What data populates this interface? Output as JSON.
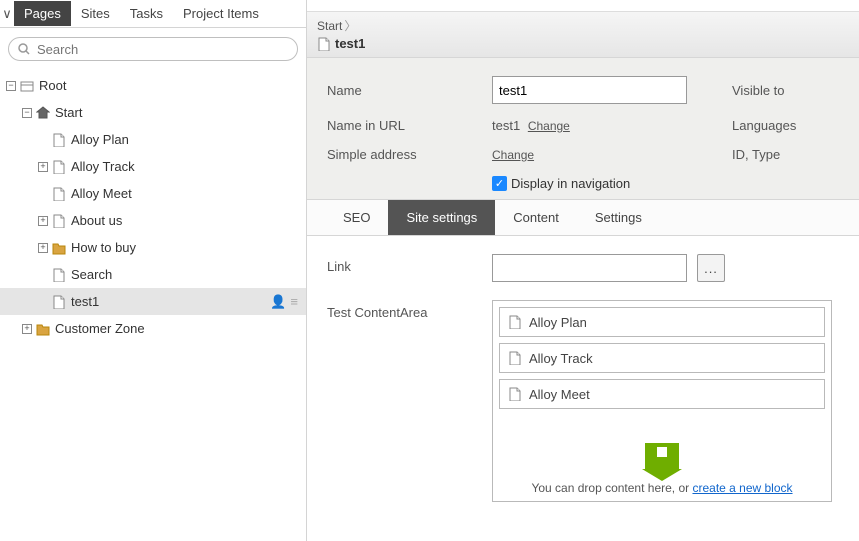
{
  "sidebar": {
    "tabs": [
      {
        "label": "Pages",
        "active": true
      },
      {
        "label": "Sites",
        "active": false
      },
      {
        "label": "Tasks",
        "active": false
      },
      {
        "label": "Project Items",
        "active": false
      }
    ],
    "search_placeholder": "Search",
    "tree": {
      "root_label": "Root",
      "start_label": "Start",
      "items": [
        {
          "label": "Alloy Plan",
          "type": "page",
          "expander": null
        },
        {
          "label": "Alloy Track",
          "type": "page",
          "expander": "+"
        },
        {
          "label": "Alloy Meet",
          "type": "page",
          "expander": null
        },
        {
          "label": "About us",
          "type": "page",
          "expander": "+"
        },
        {
          "label": "How to buy",
          "type": "folder",
          "expander": "+"
        },
        {
          "label": "Search",
          "type": "page",
          "expander": null
        },
        {
          "label": "test1",
          "type": "page",
          "expander": null,
          "selected": true
        }
      ],
      "customer_zone_label": "Customer Zone"
    }
  },
  "breadcrumb": {
    "root": "Start",
    "current": "test1"
  },
  "form": {
    "name_label": "Name",
    "name_value": "test1",
    "url_label": "Name in URL",
    "url_value": "test1",
    "change_label": "Change",
    "simple_label": "Simple address",
    "display_nav": "Display in navigation",
    "visible_label": "Visible to",
    "languages_label": "Languages",
    "idtype_label": "ID, Type"
  },
  "editor_tabs": [
    {
      "label": "SEO",
      "active": false
    },
    {
      "label": "Site settings",
      "active": true
    },
    {
      "label": "Content",
      "active": false
    },
    {
      "label": "Settings",
      "active": false
    }
  ],
  "fields": {
    "link_label": "Link",
    "picker_label": "...",
    "ca_label": "Test ContentArea",
    "ca_items": [
      {
        "label": "Alloy Plan"
      },
      {
        "label": "Alloy Track"
      },
      {
        "label": "Alloy Meet"
      }
    ],
    "drop_text": "You can drop content here, or ",
    "drop_link": "create a new block"
  }
}
